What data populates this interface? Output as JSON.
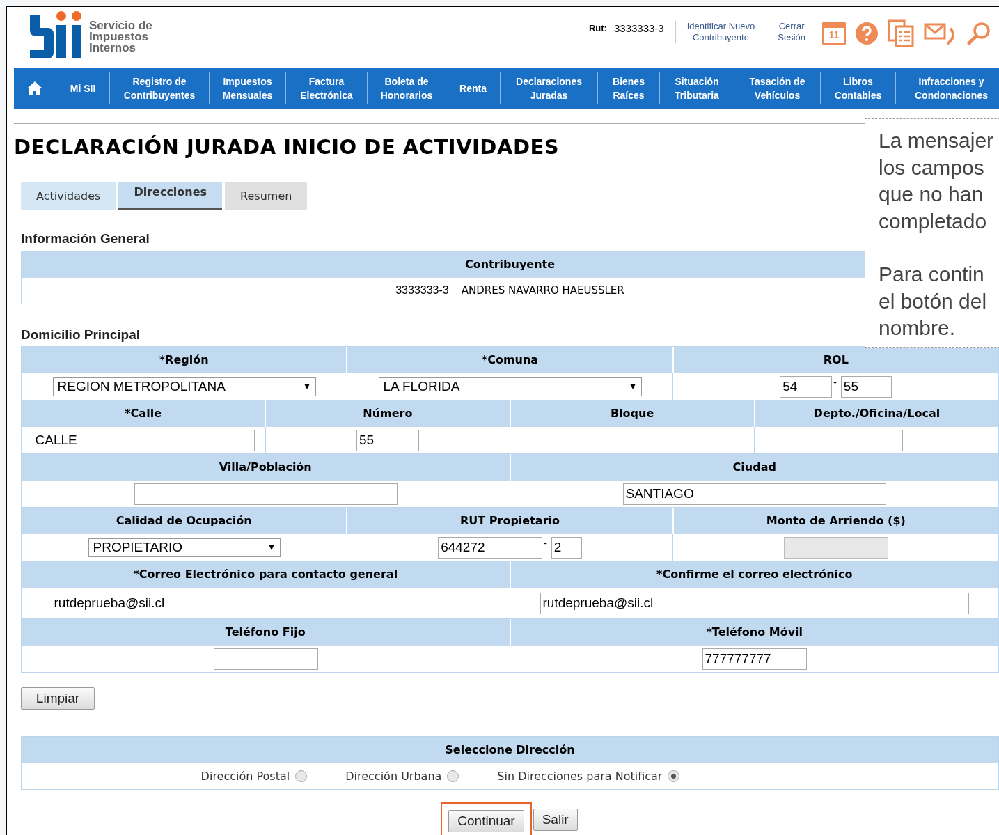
{
  "header": {
    "logo_lines": [
      "Servicio de",
      "Impuestos",
      "Internos"
    ],
    "rut_label": "Rut:",
    "rut": "3333333-3",
    "links": [
      {
        "lines": [
          "Identificar Nuevo",
          "Contribuyente"
        ]
      },
      {
        "lines": [
          "Cerrar",
          "Sesión"
        ]
      }
    ],
    "calendar_day": "11"
  },
  "nav": [
    {
      "kind": "home"
    },
    {
      "kind": "link",
      "lines": [
        "Mi SII"
      ]
    },
    {
      "kind": "link",
      "lines": [
        "Registro de",
        "Contribuyentes"
      ]
    },
    {
      "kind": "link",
      "lines": [
        "Impuestos",
        "Mensuales"
      ]
    },
    {
      "kind": "link",
      "lines": [
        "Factura",
        "Electrónica"
      ]
    },
    {
      "kind": "link",
      "lines": [
        "Boleta de",
        "Honorarios"
      ]
    },
    {
      "kind": "link",
      "lines": [
        "Renta"
      ]
    },
    {
      "kind": "link",
      "lines": [
        "Declaraciones",
        "Juradas"
      ]
    },
    {
      "kind": "link",
      "lines": [
        "Bienes",
        "Raíces"
      ]
    },
    {
      "kind": "link",
      "lines": [
        "Situación",
        "Tributaria"
      ]
    },
    {
      "kind": "link",
      "lines": [
        "Tasación de",
        "Vehículos"
      ]
    },
    {
      "kind": "link",
      "lines": [
        "Libros",
        "Contables"
      ]
    },
    {
      "kind": "link",
      "lines": [
        "Infracciones y",
        "Condonaciones"
      ]
    }
  ],
  "title": "DECLARACIÓN JURADA INICIO DE ACTIVIDADES",
  "tooltip": {
    "paragraphs": [
      [
        "La mensajer",
        "los campos",
        "que no han",
        "completado"
      ],
      [
        "Para contin",
        "el botón del",
        "nombre."
      ]
    ]
  },
  "tabs": [
    {
      "label": "Actividades",
      "selected": false,
      "completed": true
    },
    {
      "label": "Direcciones",
      "selected": true
    },
    {
      "label": "Resumen",
      "selected": false,
      "completed": false
    }
  ],
  "info_general": {
    "title": "Información General",
    "header": "Contribuyente",
    "rut": "3333333-3",
    "name": "ANDRES NAVARRO HAEUSSLER"
  },
  "domicilio": {
    "title": "Domicilio Principal",
    "rows": [
      {
        "cells": [
          {
            "header": "*Región",
            "fields": [
              {
                "kind": "select",
                "value": "REGION METROPOLITANA"
              }
            ]
          },
          {
            "header": "*Comuna",
            "fields": [
              {
                "kind": "select",
                "value": "LA FLORIDA"
              }
            ]
          },
          {
            "header": "ROL",
            "fields": [
              {
                "kind": "input",
                "value": "54"
              },
              {
                "kind": "input",
                "value": "55"
              }
            ],
            "separator": "-"
          }
        ]
      },
      {
        "cells": [
          {
            "header": "*Calle",
            "fields": [
              {
                "kind": "input",
                "value": "CALLE"
              }
            ]
          },
          {
            "header": "Número",
            "fields": [
              {
                "kind": "input",
                "value": "55"
              }
            ]
          },
          {
            "header": "Bloque",
            "fields": [
              {
                "kind": "input"
              }
            ]
          },
          {
            "header": "Depto./Oficina/Local",
            "fields": [
              {
                "kind": "input"
              }
            ]
          }
        ]
      },
      {
        "cells": [
          {
            "header": "Villa/Población",
            "fields": [
              {
                "kind": "input"
              }
            ]
          },
          {
            "header": "Ciudad",
            "fields": [
              {
                "kind": "input",
                "value": "SANTIAGO"
              }
            ]
          }
        ]
      },
      {
        "cells": [
          {
            "header": "Calidad de Ocupación",
            "fields": [
              {
                "kind": "select",
                "value": "PROPIETARIO"
              }
            ]
          },
          {
            "header": "RUT Propietario",
            "fields": [
              {
                "kind": "input",
                "value": "644272"
              },
              {
                "kind": "input",
                "value": "2"
              }
            ],
            "separator": "-"
          },
          {
            "header": "Monto de Arriendo ($)",
            "fields": [
              {
                "kind": "disabled"
              }
            ]
          }
        ]
      },
      {
        "cells": [
          {
            "header": "*Correo Electrónico para contacto general",
            "fields": [
              {
                "kind": "input",
                "value": "rutdeprueba@sii.cl"
              }
            ]
          },
          {
            "header": "*Confirme el correo electrónico",
            "fields": [
              {
                "kind": "input",
                "value": "rutdeprueba@sii.cl"
              }
            ]
          }
        ]
      },
      {
        "cells": [
          {
            "header": "Teléfono Fijo",
            "fields": [
              {
                "kind": "input"
              }
            ]
          },
          {
            "header": "*Teléfono Móvil",
            "fields": [
              {
                "kind": "input",
                "value": "777777777"
              }
            ]
          }
        ]
      }
    ]
  },
  "clear_button": "Limpiar",
  "address_select": {
    "header": "Seleccione Dirección",
    "options": [
      {
        "label": "Dirección Postal",
        "selected": false
      },
      {
        "label": "Dirección Urbana",
        "selected": false
      },
      {
        "label": "Sin Direcciones para Notificar",
        "selected": true
      }
    ]
  },
  "buttons": [
    {
      "label": "Continuar",
      "highlighted": true
    },
    {
      "label": "Salir",
      "highlighted": false
    }
  ]
}
